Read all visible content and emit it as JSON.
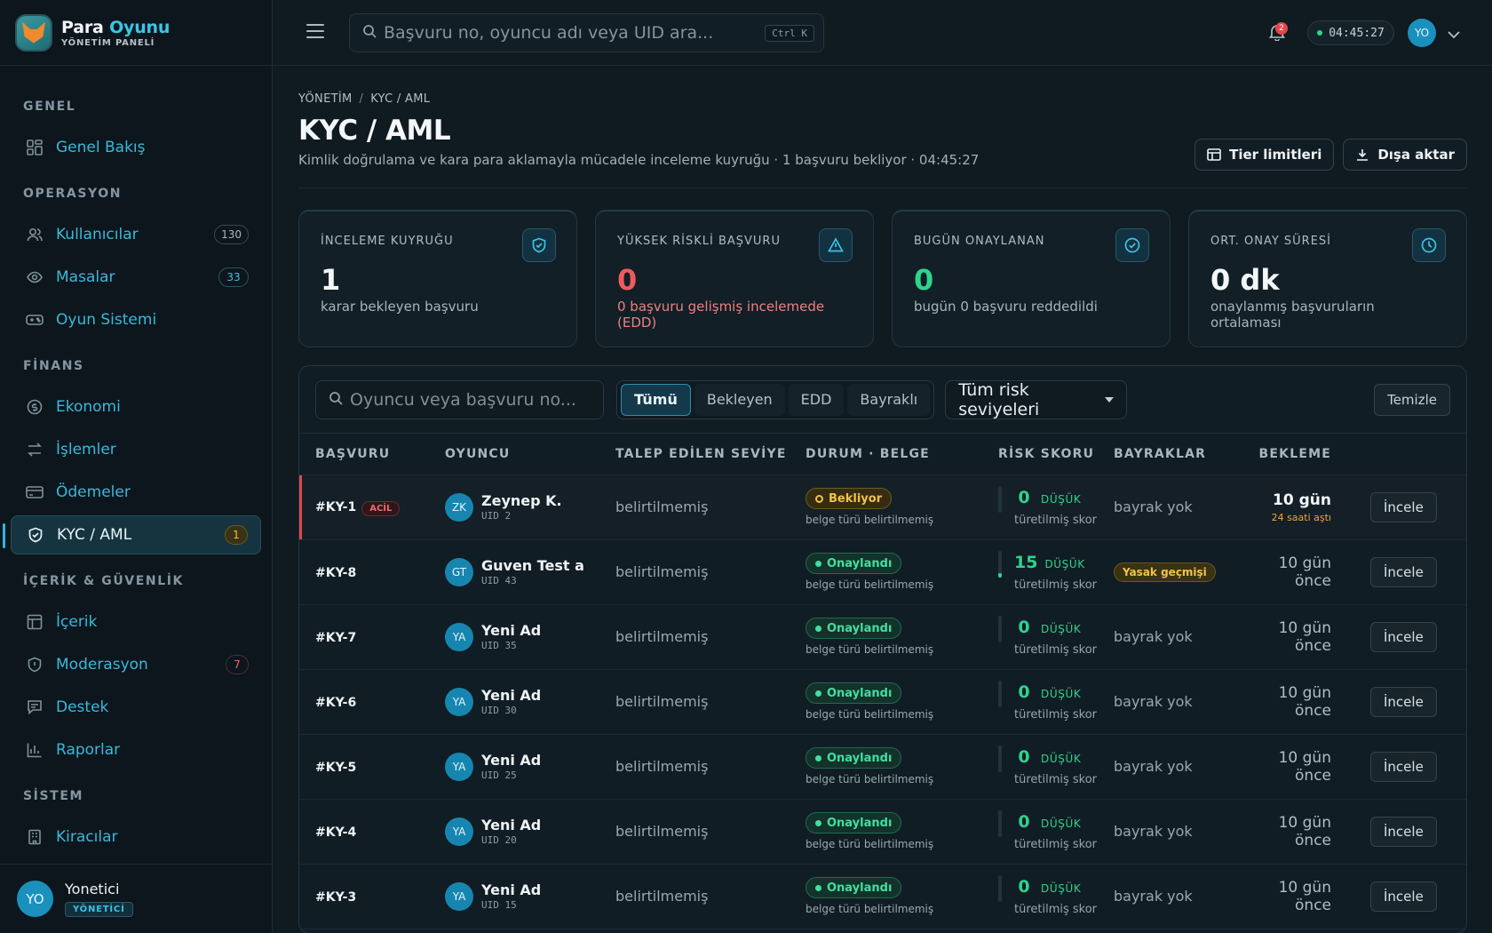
{
  "brand": {
    "title_a": "Para",
    "title_b": "Oyunu",
    "subtitle": "YÖNETİM PANELİ"
  },
  "colors": {
    "accent": "#3cc6e6",
    "danger": "#ef5a5a",
    "success": "#2fd38e",
    "warning": "#f1c24a",
    "background": "#0f1a21"
  },
  "sidebar": {
    "sections": {
      "genel": "GENEL",
      "operasyon": "OPERASYON",
      "finans": "FİNANS",
      "icerik": "İÇERİK & GÜVENLİK",
      "sistem": "SİSTEM"
    },
    "items": [
      {
        "label": "Genel Bakış",
        "icon": "grid-icon"
      },
      {
        "label": "Kullanıcılar",
        "icon": "users-icon",
        "count": "130"
      },
      {
        "label": "Masalar",
        "icon": "eye-icon",
        "count": "33"
      },
      {
        "label": "Oyun Sistemi",
        "icon": "gamepad-icon"
      },
      {
        "label": "Ekonomi",
        "icon": "coin-icon"
      },
      {
        "label": "İşlemler",
        "icon": "transfer-icon"
      },
      {
        "label": "Ödemeler",
        "icon": "card-icon"
      },
      {
        "label": "KYC / AML",
        "icon": "shield-check-icon",
        "count": "1"
      },
      {
        "label": "İçerik",
        "icon": "layout-icon"
      },
      {
        "label": "Moderasyon",
        "icon": "shield-icon",
        "count": "7"
      },
      {
        "label": "Destek",
        "icon": "chat-icon"
      },
      {
        "label": "Raporlar",
        "icon": "bar-chart-icon"
      },
      {
        "label": "Kiracılar",
        "icon": "building-icon"
      }
    ],
    "user": {
      "initials": "YO",
      "name": "Yonetici",
      "role": "YÖNETİCİ"
    }
  },
  "topbar": {
    "search_placeholder": "Başvuru no, oyuncu adı veya UID ara...",
    "shortcut": "Ctrl K",
    "notifications": "2",
    "clock": "04:45:27",
    "avatar": "YO"
  },
  "page": {
    "breadcrumb": [
      "YÖNETİM",
      "KYC / AML"
    ],
    "title": "KYC / AML",
    "subtitle": "Kimlik doğrulama ve kara para aklamayla mücadele inceleme kuyruğu · 1 başvuru bekliyor · 04:45:27",
    "actions": {
      "tier_limits": "Tier limitleri",
      "export": "Dışa aktar"
    }
  },
  "kpis": [
    {
      "label": "İNCELEME KUYRUĞU",
      "value": "1",
      "note": "karar bekleyen başvuru",
      "icon": "shield-check-icon"
    },
    {
      "label": "YÜKSEK RİSKLİ BAŞVURU",
      "value": "0",
      "note": "0 başvuru gelişmiş incelemede (EDD)",
      "icon": "warning-icon"
    },
    {
      "label": "BUGÜN ONAYLANAN",
      "value": "0",
      "note": "bugün 0 başvuru reddedildi",
      "icon": "check-circle-icon"
    },
    {
      "label": "ORT. ONAY SÜRESİ",
      "value": "0 dk",
      "note": "onaylanmış başvuruların ortalaması",
      "icon": "clock-icon"
    }
  ],
  "filters": {
    "search_placeholder": "Oyuncu veya başvuru no...",
    "tabs": [
      "Tümü",
      "Bekleyen",
      "EDD",
      "Bayraklı"
    ],
    "active_tab": "Tümü",
    "risk_select": "Tüm risk seviyeleri",
    "clear": "Temizle"
  },
  "table": {
    "columns": [
      "BAŞVURU",
      "OYUNCU",
      "TALEP EDİLEN SEVİYE",
      "DURUM · BELGE",
      "RİSK SKORU",
      "BAYRAKLAR",
      "BEKLEME"
    ],
    "review_label": "İncele",
    "rows": [
      {
        "id": "#KY-1",
        "urgent": "ACİL",
        "initials": "ZK",
        "name": "Zeynep K.",
        "uid": "UID 2",
        "tier": "belirtilmemiş",
        "status": "Bekliyor",
        "status_type": "wait",
        "doc": "belge türü belirtilmemiş",
        "risk": "0",
        "risk_level": "DÜŞÜK",
        "risk_sub": "türetilmiş skor",
        "flags": "bayrak yok",
        "flag_type": "none",
        "wait": "10 gün",
        "wait_sub": "24 saati aştı"
      },
      {
        "id": "#KY-8",
        "initials": "GT",
        "name": "Guven Test a",
        "uid": "UID 43",
        "tier": "belirtilmemiş",
        "status": "Onaylandı",
        "status_type": "ok",
        "doc": "belge türü belirtilmemiş",
        "risk": "15",
        "risk_level": "DÜŞÜK",
        "risk_sub": "türetilmiş skor",
        "flags": "Yasak geçmişi",
        "flag_type": "pill",
        "wait": "10 gün önce"
      },
      {
        "id": "#KY-7",
        "initials": "YA",
        "name": "Yeni Ad",
        "uid": "UID 35",
        "tier": "belirtilmemiş",
        "status": "Onaylandı",
        "status_type": "ok",
        "doc": "belge türü belirtilmemiş",
        "risk": "0",
        "risk_level": "DÜŞÜK",
        "risk_sub": "türetilmiş skor",
        "flags": "bayrak yok",
        "flag_type": "none",
        "wait": "10 gün önce"
      },
      {
        "id": "#KY-6",
        "initials": "YA",
        "name": "Yeni Ad",
        "uid": "UID 30",
        "tier": "belirtilmemiş",
        "status": "Onaylandı",
        "status_type": "ok",
        "doc": "belge türü belirtilmemiş",
        "risk": "0",
        "risk_level": "DÜŞÜK",
        "risk_sub": "türetilmiş skor",
        "flags": "bayrak yok",
        "flag_type": "none",
        "wait": "10 gün önce"
      },
      {
        "id": "#KY-5",
        "initials": "YA",
        "name": "Yeni Ad",
        "uid": "UID 25",
        "tier": "belirtilmemiş",
        "status": "Onaylandı",
        "status_type": "ok",
        "doc": "belge türü belirtilmemiş",
        "risk": "0",
        "risk_level": "DÜŞÜK",
        "risk_sub": "türetilmiş skor",
        "flags": "bayrak yok",
        "flag_type": "none",
        "wait": "10 gün önce"
      },
      {
        "id": "#KY-4",
        "initials": "YA",
        "name": "Yeni Ad",
        "uid": "UID 20",
        "tier": "belirtilmemiş",
        "status": "Onaylandı",
        "status_type": "ok",
        "doc": "belge türü belirtilmemiş",
        "risk": "0",
        "risk_level": "DÜŞÜK",
        "risk_sub": "türetilmiş skor",
        "flags": "bayrak yok",
        "flag_type": "none",
        "wait": "10 gün önce"
      },
      {
        "id": "#KY-3",
        "initials": "YA",
        "name": "Yeni Ad",
        "uid": "UID 15",
        "tier": "belirtilmemiş",
        "status": "Onaylandı",
        "status_type": "ok",
        "doc": "belge türü belirtilmemiş",
        "risk": "0",
        "risk_level": "DÜŞÜK",
        "risk_sub": "türetilmiş skor",
        "flags": "bayrak yok",
        "flag_type": "none",
        "wait": "10 gün önce"
      }
    ]
  }
}
